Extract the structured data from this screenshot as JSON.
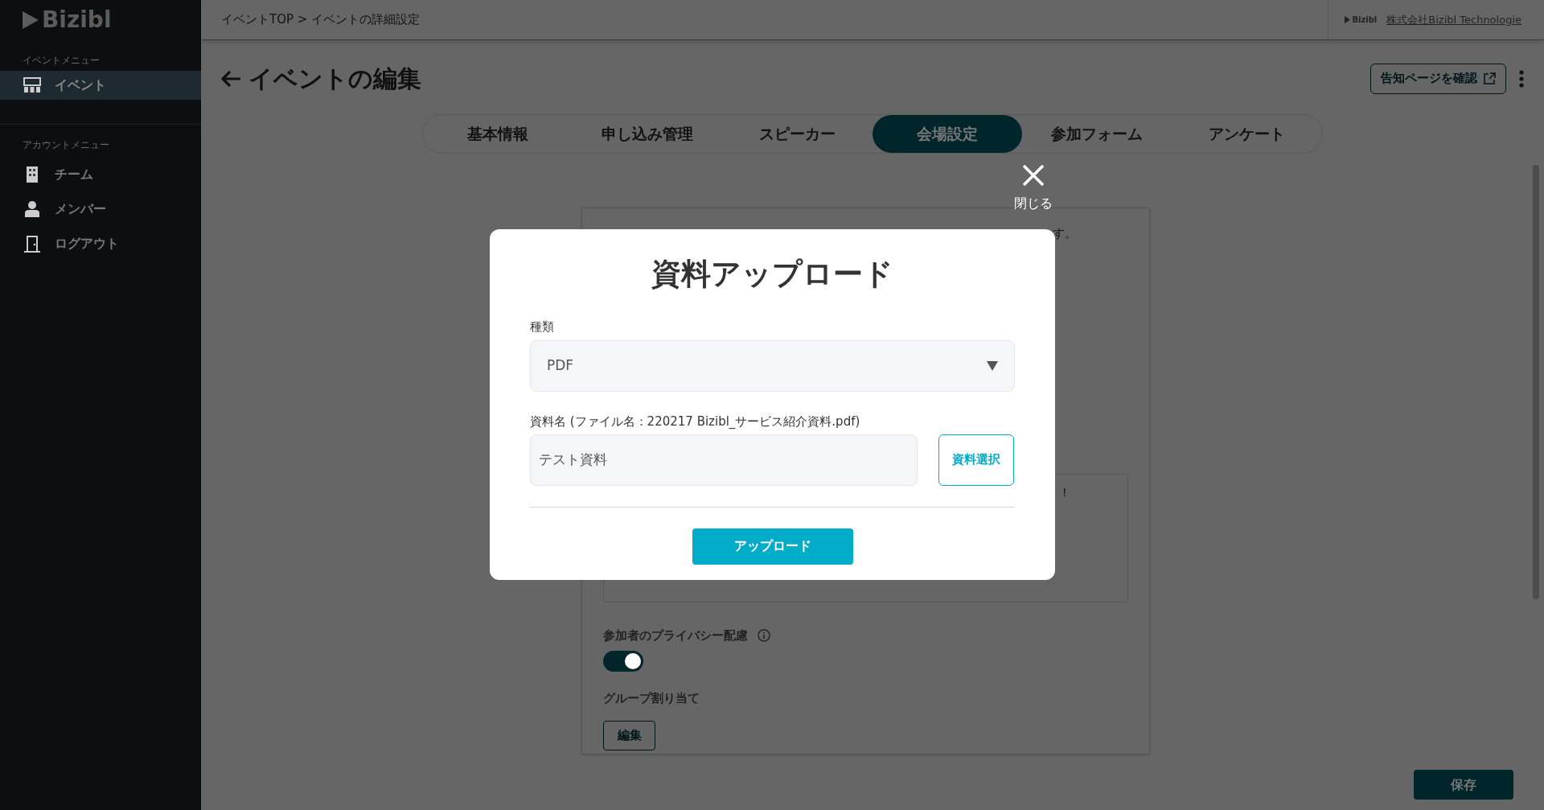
{
  "sidebar": {
    "logo": "Bizibl",
    "sections": [
      {
        "heading": "イベントメニュー",
        "items": [
          {
            "label": "イベント",
            "selected": true
          }
        ]
      },
      {
        "heading": "アカウントメニュー",
        "items": [
          {
            "label": "チーム",
            "selected": false
          },
          {
            "label": "メンバー",
            "selected": false
          },
          {
            "label": "ログアウト",
            "selected": false
          }
        ]
      }
    ]
  },
  "header": {
    "breadcrumb": "イベントTOP > イベントの詳細設定",
    "company_logo": "Bizibl",
    "company_link": "株式会社Bizibl Technologie"
  },
  "page": {
    "title": "イベントの編集",
    "preview_button": "告知ページを確認"
  },
  "tabs": [
    {
      "label": "基本情報",
      "selected": false
    },
    {
      "label": "申し込み管理",
      "selected": false
    },
    {
      "label": "スピーカー",
      "selected": false
    },
    {
      "label": "会場設定",
      "selected": true
    },
    {
      "label": "参加フォーム",
      "selected": false
    },
    {
      "label": "アンケート",
      "selected": false
    }
  ],
  "card": {
    "text_fragment": "す。",
    "textarea_fragment": "!",
    "privacy_label": "参加者のプライバシー配慮",
    "privacy_on": true,
    "group_label": "グループ割り当て",
    "group_edit_button": "編集"
  },
  "save_button": "保存",
  "modal": {
    "close_label": "閉じる",
    "title": "資料アップロード",
    "type_label": "種類",
    "type_value": "PDF",
    "name_label": "資料名 (ファイル名：220217 Bizibl_サービス紹介資料.pdf)",
    "name_value": "テスト資料",
    "select_button": "資料選択",
    "upload_button": "アップロード"
  }
}
